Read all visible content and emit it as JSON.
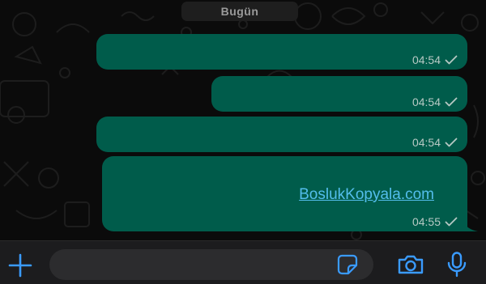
{
  "chat": {
    "date_label": "Bugün",
    "messages": [
      {
        "text": "",
        "time": "04:54",
        "status": "sent"
      },
      {
        "text": "",
        "time": "04:54",
        "status": "sent"
      },
      {
        "text": "",
        "time": "04:54",
        "status": "sent"
      },
      {
        "text": "BoslukKopyala.com",
        "time": "04:55",
        "status": "sent"
      }
    ]
  },
  "input_bar": {
    "message_placeholder": "",
    "icons": [
      "plus-icon",
      "sticker-icon",
      "camera-icon",
      "microphone-icon"
    ]
  },
  "colors": {
    "outgoing_bubble": "#005c4b",
    "link": "#53bdeb",
    "accent_icons": "#3a9bff",
    "background": "#0b0b0b"
  }
}
